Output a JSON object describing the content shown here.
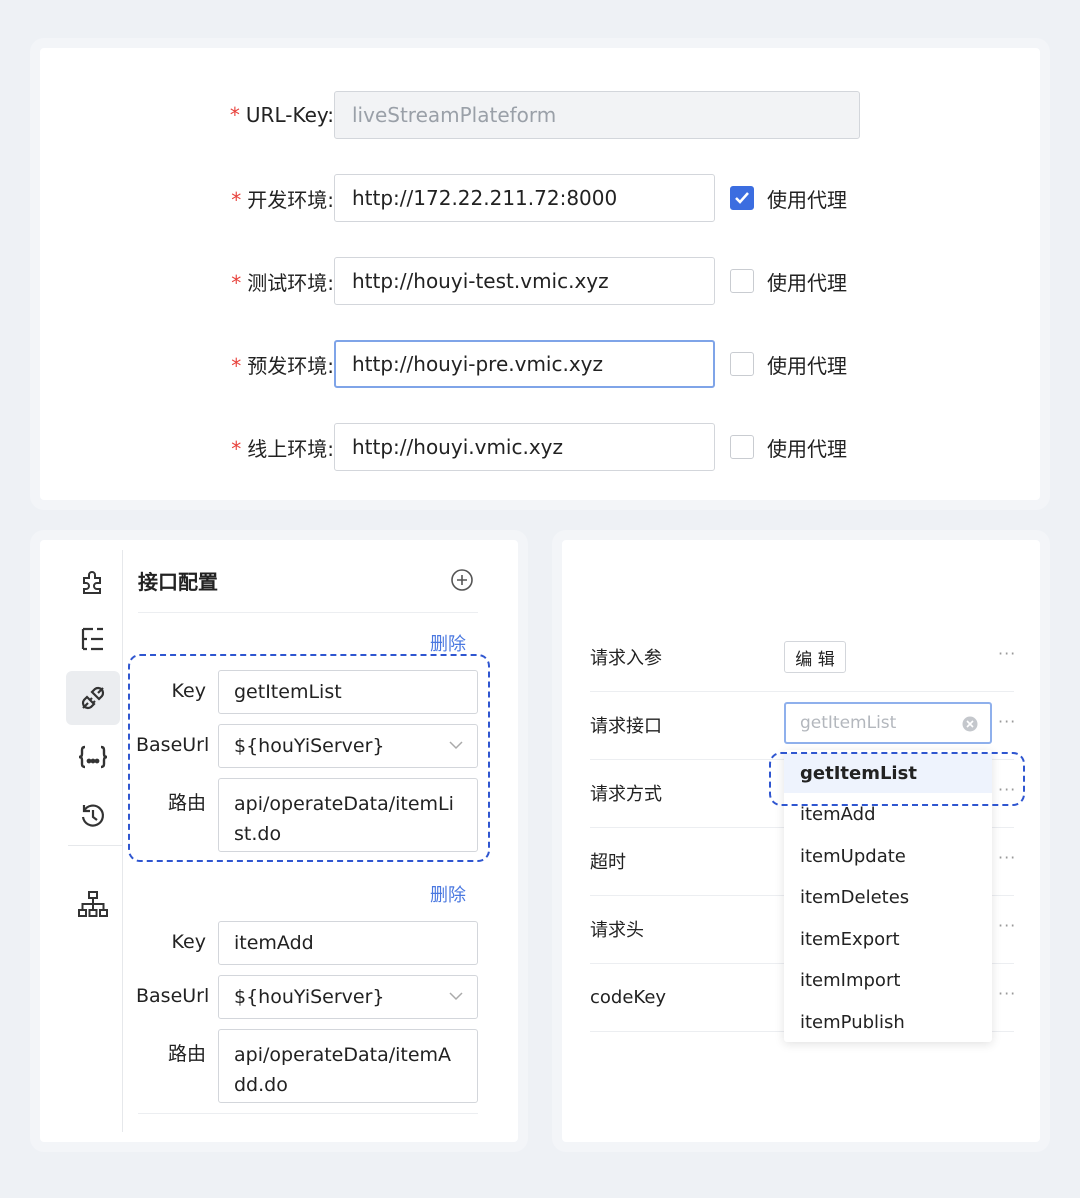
{
  "env_form": {
    "fields": [
      {
        "label": "URL-Key:",
        "value": "liveStreamPlateform",
        "disabled": true
      },
      {
        "label": "开发环境:",
        "value": "http://172.22.211.72:8000",
        "proxy_label": "使用代理",
        "proxy_checked": true
      },
      {
        "label": "测试环境:",
        "value": "http://houyi-test.vmic.xyz",
        "proxy_label": "使用代理",
        "proxy_checked": false
      },
      {
        "label": "预发环境:",
        "value": "http://houyi-pre.vmic.xyz",
        "proxy_label": "使用代理",
        "proxy_checked": false,
        "focused": true
      },
      {
        "label": "线上环境:",
        "value": "http://houyi.vmic.xyz",
        "proxy_label": "使用代理",
        "proxy_checked": false
      }
    ],
    "required_mark": "*"
  },
  "sidebar": {
    "icons": [
      "puzzle-icon",
      "tree-list-icon",
      "plug-icon",
      "json-braces-icon",
      "history-icon",
      "sitemap-icon"
    ],
    "active": "plug-icon"
  },
  "endpoint_panel": {
    "title": "接口配置",
    "delete_label": "删除",
    "field_labels": {
      "key": "Key",
      "baseurl": "BaseUrl",
      "route": "路由"
    },
    "endpoints": [
      {
        "key": "getItemList",
        "baseurl": "${houYiServer}",
        "route": "api/operateData/itemList.do"
      },
      {
        "key": "itemAdd",
        "baseurl": "${houYiServer}",
        "route": "api/operateData/itemAdd.do"
      }
    ]
  },
  "request_panel": {
    "rows": [
      {
        "label": "请求入参"
      },
      {
        "label": "请求接口"
      },
      {
        "label": "请求方式"
      },
      {
        "label": "超时"
      },
      {
        "label": "请求头"
      },
      {
        "label": "codeKey"
      }
    ],
    "more_label": "···",
    "edit_button": "编 辑",
    "select_placeholder": "getItemList",
    "dropdown_options": [
      "getItemList",
      "itemAdd",
      "itemUpdate",
      "itemDeletes",
      "itemExport",
      "itemImport",
      "itemPublish"
    ],
    "dropdown_selected": "getItemList"
  },
  "colors": {
    "accent": "#3b6de0",
    "required": "#e8413b",
    "link": "#4a78e0",
    "dash_highlight": "#2f56d0"
  }
}
